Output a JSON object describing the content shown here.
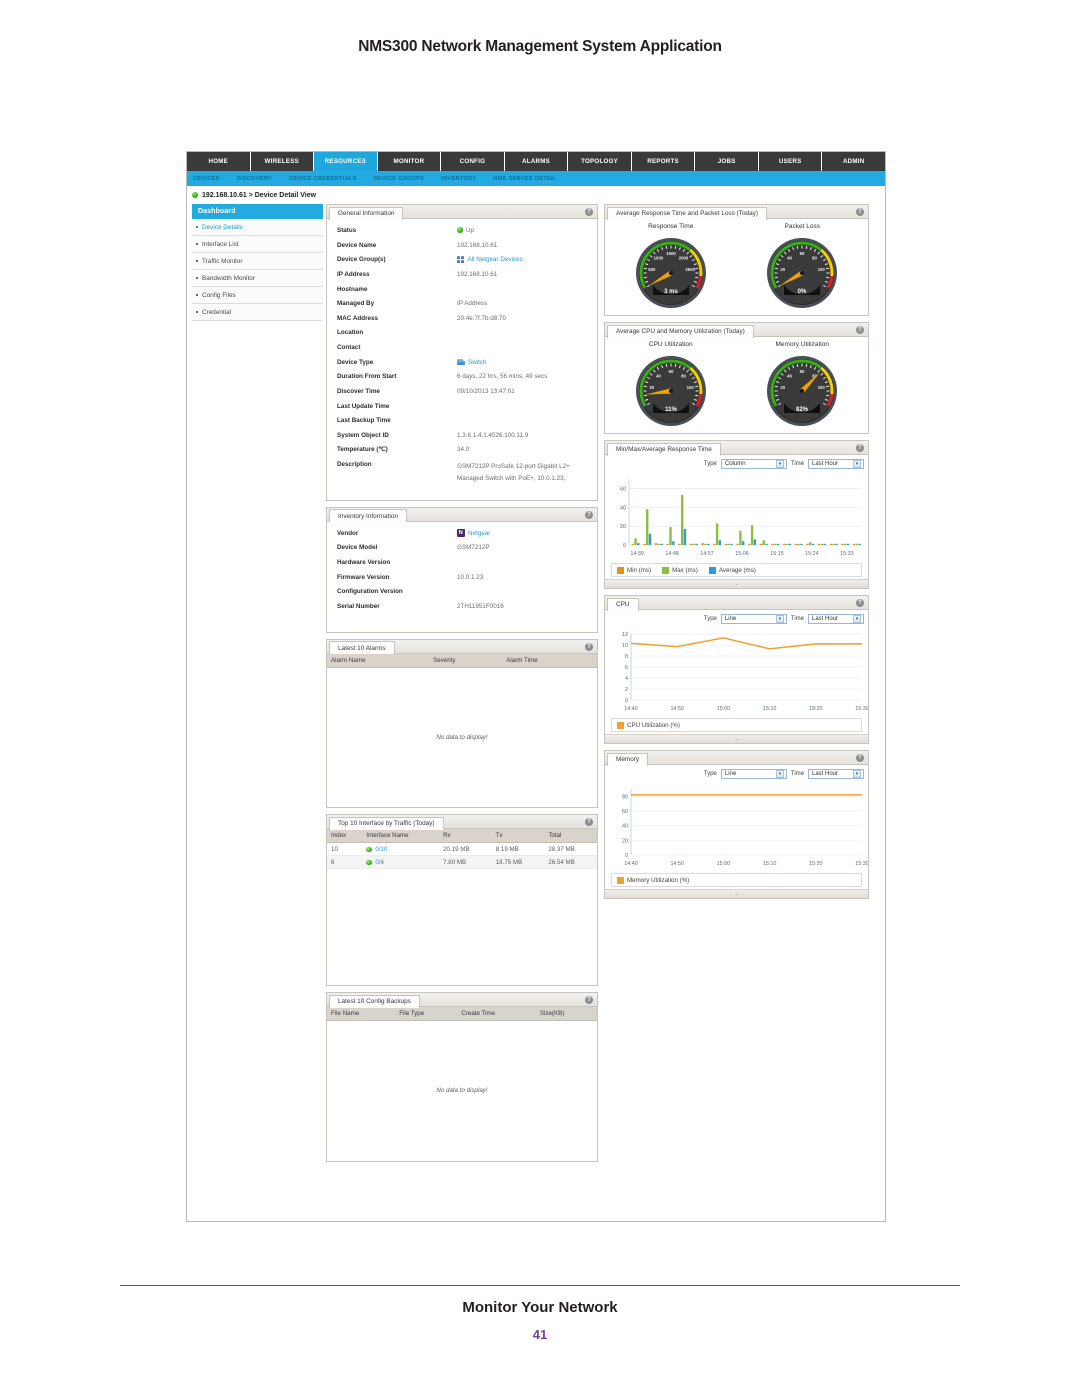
{
  "document": {
    "header_title": "NMS300 Network Management System Application",
    "footer_title": "Monitor Your Network",
    "page_number": "41"
  },
  "topnav": [
    {
      "label": "HOME",
      "active": false
    },
    {
      "label": "WIRELESS",
      "active": false
    },
    {
      "label": "RESOURCES",
      "active": true
    },
    {
      "label": "MONITOR",
      "active": false
    },
    {
      "label": "CONFIG",
      "active": false
    },
    {
      "label": "ALARMS",
      "active": false
    },
    {
      "label": "TOPOLOGY",
      "active": false
    },
    {
      "label": "REPORTS",
      "active": false
    },
    {
      "label": "JOBS",
      "active": false
    },
    {
      "label": "USERS",
      "active": false
    },
    {
      "label": "ADMIN",
      "active": false
    }
  ],
  "subnav": [
    {
      "label": "DEVICES"
    },
    {
      "label": "DISCOVERY"
    },
    {
      "label": "DEVICE CREDENTIALS"
    },
    {
      "label": "DEVICE GROUPS"
    },
    {
      "label": "INVENTORY"
    },
    {
      "label": "NMS SERVER DETAIL"
    }
  ],
  "breadcrumb": "192.168.10.61 > Device Detail View",
  "sidebar": {
    "header": "Dashboard",
    "items": [
      {
        "label": "Device Details",
        "selected": true
      },
      {
        "label": "Interface List",
        "selected": false
      },
      {
        "label": "Traffic Monitor",
        "selected": false
      },
      {
        "label": "Bandwidth Monitor",
        "selected": false
      },
      {
        "label": "Config Files",
        "selected": false
      },
      {
        "label": "Credential",
        "selected": false
      }
    ]
  },
  "general_information": {
    "title": "General Information",
    "help": "?",
    "rows": [
      {
        "key": "Status",
        "value": "Up",
        "icon": "status-up-dot"
      },
      {
        "key": "Device Name",
        "value": "192.168.10.61",
        "icon": ""
      },
      {
        "key": "Device Group(s)",
        "value": "All Netgear Devices",
        "icon": "device-group-icon"
      },
      {
        "key": "IP Address",
        "value": "192.168.10.61",
        "icon": ""
      },
      {
        "key": "Hostname",
        "value": "",
        "icon": ""
      },
      {
        "key": "Managed By",
        "value": "IP Address",
        "icon": ""
      },
      {
        "key": "MAC Address",
        "value": "20:4e:7f:7b:d8:70",
        "icon": ""
      },
      {
        "key": "Location",
        "value": "",
        "icon": ""
      },
      {
        "key": "Contact",
        "value": "",
        "icon": ""
      },
      {
        "key": "Device Type",
        "value": "Switch",
        "icon": "switch-icon"
      },
      {
        "key": "Duration From Start",
        "value": "6 days, 22 hrs, 56 mins, 49 secs",
        "icon": ""
      },
      {
        "key": "Discover Time",
        "value": "09/10/2013 13:47:01",
        "icon": ""
      },
      {
        "key": "Last Update Time",
        "value": "",
        "icon": ""
      },
      {
        "key": "Last Backup Time",
        "value": "",
        "icon": ""
      },
      {
        "key": "System Object ID",
        "value": "1.3.6.1.4.1.4526.100.11.9",
        "icon": ""
      },
      {
        "key": "Temperature (℃)",
        "value": "34.0",
        "icon": ""
      },
      {
        "key": "Description",
        "value": "GSM7212P ProSafe 12-port Gigabit L2+ Managed Switch with PoE+, 10.0.1.23,",
        "icon": ""
      }
    ]
  },
  "inventory_information": {
    "title": "Inventory Information",
    "help": "?",
    "rows": [
      {
        "key": "Vendor",
        "value": "Netgear",
        "icon": "netgear-vendor-icon"
      },
      {
        "key": "Device Model",
        "value": "GSM7212P",
        "icon": ""
      },
      {
        "key": "Hardware Version",
        "value": "",
        "icon": ""
      },
      {
        "key": "Firmware Version",
        "value": "10.0.1.23",
        "icon": ""
      },
      {
        "key": "Configuration Version",
        "value": "",
        "icon": ""
      },
      {
        "key": "Serial Number",
        "value": "2TH11951F0016",
        "icon": ""
      }
    ]
  },
  "alarms_panel": {
    "title": "Latest 10 Alarms",
    "help": "?",
    "columns": [
      "Alarm Name",
      "Severity",
      "Alarm Time"
    ],
    "rows": [],
    "empty_text": "No data to display!"
  },
  "interface_traffic_panel": {
    "title": "Top 10 Interface by Traffic (Today)",
    "help": "?",
    "columns": [
      "Index",
      "Interface Name",
      "Rx",
      "Tx",
      "Total"
    ],
    "rows": [
      {
        "index": "10",
        "name": "0/10",
        "rx": "20.19 MB",
        "tx": "8.19 MB",
        "total": "28.37 MB"
      },
      {
        "index": "6",
        "name": "0/6",
        "rx": "7.80 MB",
        "tx": "18.75 MB",
        "total": "26.54 MB"
      }
    ]
  },
  "config_backups_panel": {
    "title": "Latest 10 Config Backups",
    "help": "?",
    "columns": [
      "File Name",
      "File Type",
      "Create Time",
      "Size(KB)"
    ],
    "rows": [],
    "empty_text": "No data to display!"
  },
  "response_packet_panel": {
    "title": "Average Response Time and Packet Loss (Today)",
    "help": "?"
  },
  "cpu_memory_panel": {
    "title": "Average CPU and Memory Utilization (Today)",
    "help": "?"
  },
  "minmaxavg_panel": {
    "title": "Min/Max/Average Response Time",
    "help": "?",
    "type_label": "Type",
    "type_value": "Column",
    "time_label": "Time",
    "time_value": "Last Hour"
  },
  "cpu_panel": {
    "title": "CPU",
    "help": "?",
    "type_label": "Type",
    "type_value": "Line",
    "time_label": "Time",
    "time_value": "Last Hour"
  },
  "memory_panel": {
    "title": "Memory",
    "help": "?",
    "type_label": "Type",
    "type_value": "Line",
    "time_label": "Time",
    "time_value": "Last Hour"
  },
  "colors": {
    "accent_blue": "#22aae1",
    "nav_dark": "#3a3a3a",
    "gauge_needle": "#f2a100",
    "series_min": "#e8921d",
    "series_max": "#8cbf3f",
    "series_avg": "#3399dd",
    "line_orange": "#f0a030",
    "status_green": "#36b012"
  },
  "chart_data": [
    {
      "id": "response-time-gauge",
      "type": "gauge",
      "title": "Response Time",
      "value": 3,
      "value_label": "3 ms",
      "unit": "ms",
      "min": 0,
      "max": 3000,
      "ticks": [
        500,
        1000,
        1500,
        2000,
        2500
      ],
      "bands": [
        {
          "from": 0,
          "to": 2000,
          "color": "#36b012"
        },
        {
          "from": 2000,
          "to": 2700,
          "color": "#f2d200"
        },
        {
          "from": 2700,
          "to": 3000,
          "color": "#e02020"
        }
      ]
    },
    {
      "id": "packet-loss-gauge",
      "type": "gauge",
      "title": "Packet Loss",
      "value": 0,
      "value_label": "0%",
      "unit": "%",
      "min": 0,
      "max": 120,
      "ticks": [
        20,
        40,
        60,
        80,
        100
      ],
      "bands": [
        {
          "from": 0,
          "to": 80,
          "color": "#36b012"
        },
        {
          "from": 80,
          "to": 108,
          "color": "#f2d200"
        },
        {
          "from": 108,
          "to": 120,
          "color": "#e02020"
        }
      ]
    },
    {
      "id": "cpu-utilization-gauge",
      "type": "gauge",
      "title": "CPU Utilization",
      "value": 11,
      "value_label": "11%",
      "unit": "%",
      "min": 0,
      "max": 120,
      "ticks": [
        20,
        40,
        60,
        80,
        100
      ],
      "bands": [
        {
          "from": 0,
          "to": 80,
          "color": "#36b012"
        },
        {
          "from": 80,
          "to": 108,
          "color": "#f2d200"
        },
        {
          "from": 108,
          "to": 120,
          "color": "#e02020"
        }
      ]
    },
    {
      "id": "memory-utilization-gauge",
      "type": "gauge",
      "title": "Memory Utilization",
      "value": 82,
      "value_label": "82%",
      "unit": "%",
      "min": 0,
      "max": 120,
      "ticks": [
        20,
        40,
        60,
        80,
        100
      ],
      "bands": [
        {
          "from": 0,
          "to": 80,
          "color": "#36b012"
        },
        {
          "from": 80,
          "to": 108,
          "color": "#f2d200"
        },
        {
          "from": 108,
          "to": 120,
          "color": "#e02020"
        }
      ]
    },
    {
      "id": "minmaxavg-response-time",
      "type": "bar",
      "title": "Min/Max/Average Response Time",
      "xlabel": "",
      "ylabel": "",
      "ylim": [
        0,
        70
      ],
      "yticks": [
        0,
        20,
        40,
        60
      ],
      "grid": true,
      "legend_position": "bottom",
      "x": [
        "14:39",
        "",
        "",
        "14:48",
        "",
        "",
        "14:57",
        "",
        "",
        "15:06",
        "",
        "",
        "15:15",
        "",
        "",
        "15:24",
        "",
        "",
        "15:33",
        ""
      ],
      "tick_labels": [
        "14:39",
        "14:48",
        "14:57",
        "15:06",
        "15:15",
        "15:24",
        "15:33"
      ],
      "series": [
        {
          "name": "Min (ms)",
          "color": "#e8921d",
          "values": [
            1,
            1,
            2,
            1,
            1,
            1,
            2,
            1,
            1,
            1,
            1,
            1,
            1,
            1,
            1,
            1,
            1,
            1,
            1,
            1
          ]
        },
        {
          "name": "Max (ms)",
          "color": "#8cbf3f",
          "values": [
            7,
            38,
            1,
            19,
            53,
            1,
            1,
            23,
            1,
            15,
            21,
            5,
            1,
            1,
            1,
            3,
            1,
            1,
            1,
            1
          ]
        },
        {
          "name": "Average (ms)",
          "color": "#3399dd",
          "values": [
            2,
            12,
            1,
            4,
            17,
            1,
            1,
            5,
            1,
            4,
            6,
            1,
            1,
            1,
            1,
            1,
            1,
            1,
            1,
            1
          ]
        }
      ]
    },
    {
      "id": "cpu-utilization-line",
      "type": "line",
      "title": "CPU",
      "xlabel": "",
      "ylabel": "",
      "ylim": [
        0,
        12
      ],
      "yticks": [
        0,
        2,
        4,
        6,
        8,
        10,
        12
      ],
      "grid": true,
      "legend_position": "bottom",
      "tick_labels": [
        "14:40",
        "14:50",
        "15:00",
        "15:10",
        "15:20",
        "15:30"
      ],
      "series": [
        {
          "name": "CPU Utilization (%)",
          "color": "#f0a030",
          "x": [
            "14:40",
            "14:50",
            "15:00",
            "15:10",
            "15:20",
            "15:30"
          ],
          "values": [
            10.3,
            9.7,
            11.3,
            9.3,
            10.2,
            10.2
          ]
        }
      ]
    },
    {
      "id": "memory-utilization-line",
      "type": "line",
      "title": "Memory",
      "xlabel": "",
      "ylabel": "",
      "ylim": [
        0,
        90
      ],
      "yticks": [
        0,
        20,
        40,
        60,
        80
      ],
      "grid": true,
      "legend_position": "bottom",
      "tick_labels": [
        "14:40",
        "14:50",
        "15:00",
        "15:10",
        "15:20",
        "15:30"
      ],
      "series": [
        {
          "name": "Memory Utilization (%)",
          "color": "#f0a030",
          "x": [
            "14:40",
            "14:50",
            "15:00",
            "15:10",
            "15:20",
            "15:30"
          ],
          "values": [
            82,
            82,
            82,
            82,
            82,
            82
          ]
        }
      ]
    }
  ]
}
